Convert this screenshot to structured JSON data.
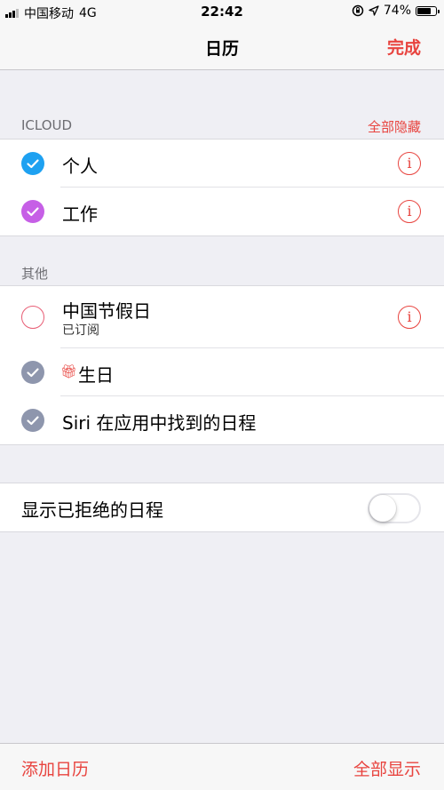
{
  "status_bar": {
    "carrier": "中国移动",
    "network": "4G",
    "time": "22:42",
    "battery_text": "74%",
    "battery_level": 0.74,
    "icons": [
      "signal-icon",
      "orientation-lock-icon",
      "location-arrow-icon",
      "battery-icon"
    ]
  },
  "nav": {
    "title": "日历",
    "done_label": "完成"
  },
  "icloud_section": {
    "header": "ICLOUD",
    "action": "全部隐藏",
    "items": [
      {
        "label": "个人",
        "checked": true,
        "color": "#1ea1f1"
      },
      {
        "label": "工作",
        "checked": true,
        "color": "#c65fe6"
      }
    ]
  },
  "other_section": {
    "header": "其他",
    "items": [
      {
        "label": "中国节假日",
        "sublabel": "已订阅",
        "checked": false,
        "color": "#e85d75"
      },
      {
        "label": "生日",
        "checked": true,
        "color": "#8e96ad",
        "icon": "gift-icon"
      },
      {
        "label": "Siri 在应用中找到的日程",
        "checked": true,
        "color": "#8e96ad"
      }
    ]
  },
  "declined": {
    "label": "显示已拒绝的日程",
    "enabled": false
  },
  "toolbar": {
    "add_label": "添加日历",
    "show_all_label": "全部显示"
  },
  "colors": {
    "accent": "#e8443f",
    "background": "#efeff4"
  }
}
